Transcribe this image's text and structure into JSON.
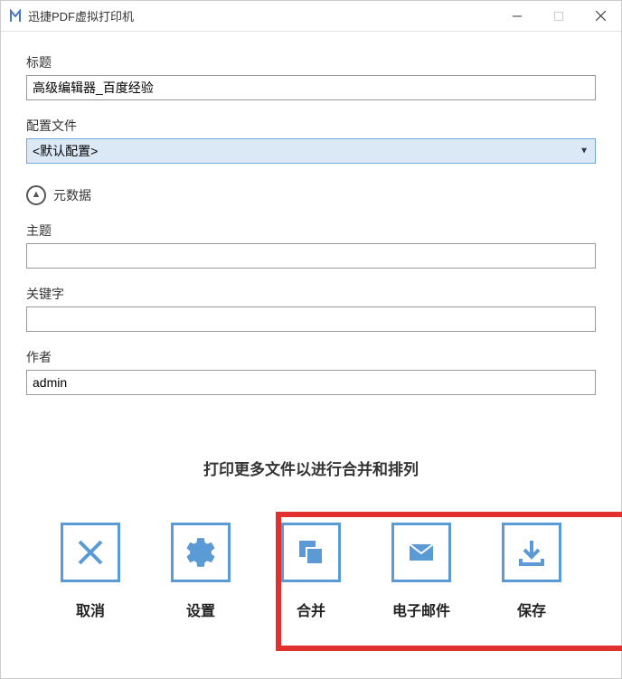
{
  "window": {
    "title": "迅捷PDF虚拟打印机"
  },
  "fields": {
    "title": {
      "label": "标题",
      "value": "高级编辑器_百度经验"
    },
    "config": {
      "label": "配置文件",
      "value": "<默认配置>"
    },
    "metadata": {
      "label": "元数据"
    },
    "subject": {
      "label": "主题",
      "value": ""
    },
    "keywords": {
      "label": "关键字",
      "value": ""
    },
    "author": {
      "label": "作者",
      "value": "admin"
    }
  },
  "hint": "打印更多文件以进行合并和排列",
  "actions": {
    "cancel": "取消",
    "settings": "设置",
    "merge": "合并",
    "email": "电子邮件",
    "save": "保存"
  }
}
